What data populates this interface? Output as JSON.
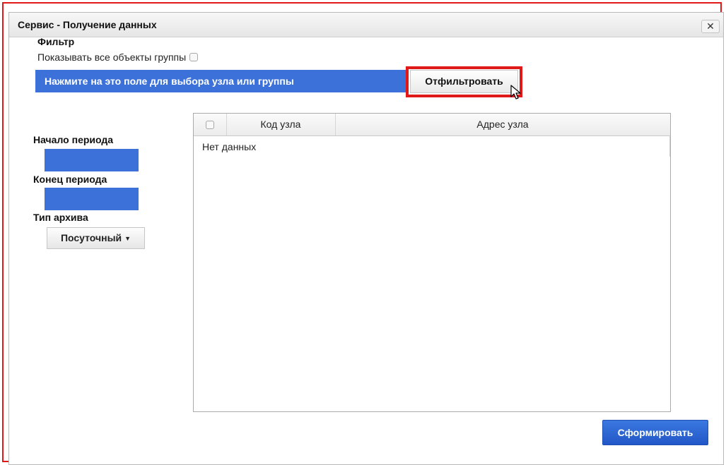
{
  "dialog": {
    "title": "Сервис - Получение данных",
    "close_label": "✕"
  },
  "filter": {
    "heading": "Фильтр",
    "show_all_label": "Показывать все объекты группы",
    "selector_text": "Нажмите на это поле для выбора узла или группы",
    "filter_button": "Отфильтровать"
  },
  "period": {
    "start_label": "Начало периода",
    "start_value": "",
    "end_label": "Конец периода",
    "end_value": ""
  },
  "archive": {
    "label": "Тип архива",
    "selected": "Посуточный"
  },
  "table": {
    "columns": [
      "",
      "Код узла",
      "Адрес узла"
    ],
    "empty_text": "Нет данных"
  },
  "actions": {
    "submit": "Сформировать"
  },
  "colors": {
    "accent_blue": "#3c71d9",
    "highlight_red": "#e01818"
  }
}
